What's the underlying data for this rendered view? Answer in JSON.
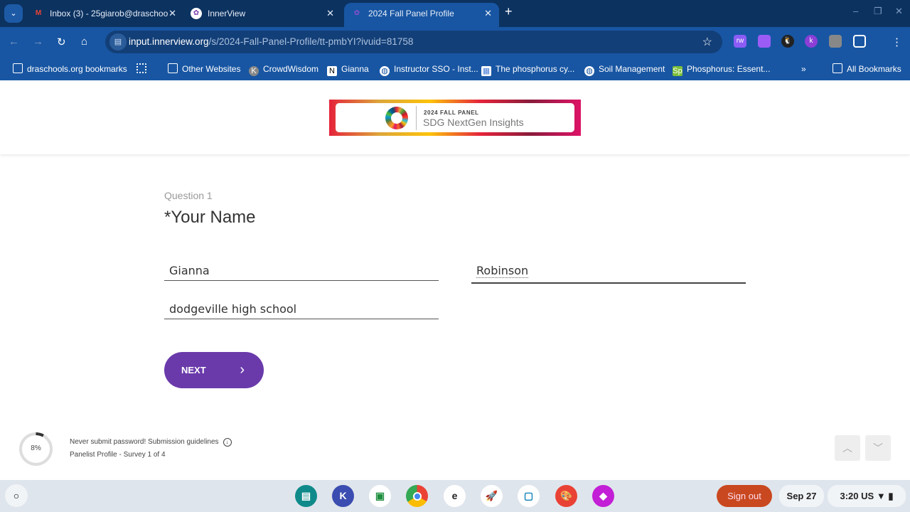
{
  "browser": {
    "tabs": [
      {
        "title": "Inbox (3) - 25giarob@draschoo",
        "icon": "gmail-icon"
      },
      {
        "title": "InnerView",
        "icon": "innerview-icon"
      },
      {
        "title": "2024 Fall Panel Profile",
        "icon": "innerview-icon",
        "active": true
      }
    ],
    "url_host": "input.innerview.org",
    "url_path": "/s/2024-Fall-Panel-Profile/tt-pmbYI?ivuid=81758",
    "bookmarks": [
      "draschools.org bookmarks",
      "Other Websites",
      "CrowdWisdom",
      "Gianna",
      "Instructor SSO - Inst...",
      "The phosphorus cy...",
      "Soil Management",
      "Phosphorus: Essent...",
      "All Bookmarks"
    ],
    "extensions": [
      "rw",
      "k"
    ]
  },
  "logo": {
    "line1": "2024 FALL PANEL",
    "line2": "SDG NextGen Insights"
  },
  "question": {
    "number": "Question 1",
    "title": "*Your Name",
    "first_name": "Gianna",
    "last_name": "Robinson",
    "school": "dodgeville high school",
    "next_label": "NEXT"
  },
  "footer": {
    "progress_percent": 8,
    "progress_label": "8%",
    "guidelines": "Never submit password! Submission guidelines",
    "survey": "Panelist Profile - Survey 1 of 4"
  },
  "shelf": {
    "sign_out": "Sign out",
    "date": "Sep 27",
    "time": "3:20",
    "region": "US"
  }
}
